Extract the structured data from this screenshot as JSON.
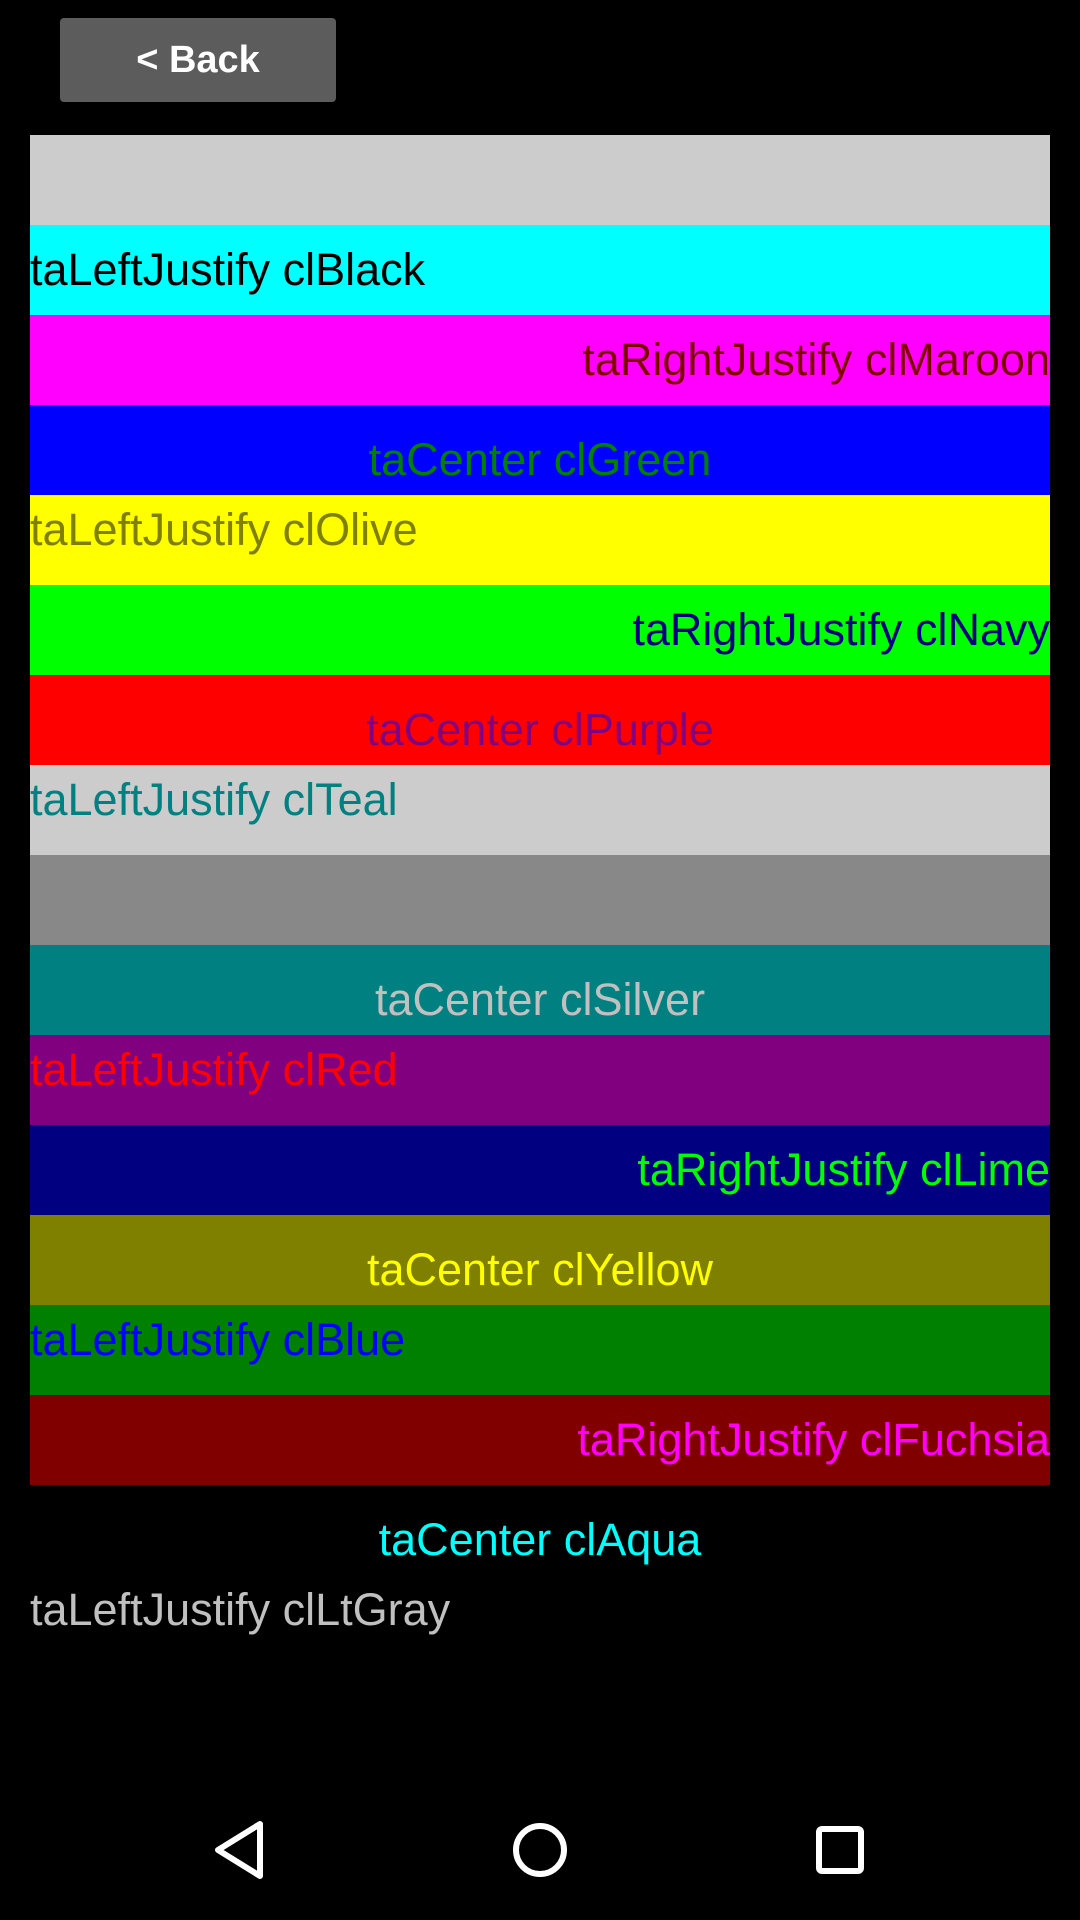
{
  "header": {
    "back_label": "< Back"
  },
  "rows": [
    {
      "text": "",
      "align": "left",
      "bg": "#cccccc",
      "fg": "#000000"
    },
    {
      "text": "taLeftJustify clBlack",
      "align": "left",
      "bg": "#00ffff",
      "fg": "#000000"
    },
    {
      "text": "taRightJustify clMaroon",
      "align": "right",
      "bg": "#ff00ff",
      "fg": "#800000"
    },
    {
      "text": "taCenter clGreen",
      "align": "center",
      "bg": "#0000ff",
      "fg": "#008000"
    },
    {
      "text": "taLeftJustify clOlive",
      "align": "left",
      "bg": "#ffff00",
      "fg": "#808000"
    },
    {
      "text": "taRightJustify clNavy",
      "align": "right",
      "bg": "#00ff00",
      "fg": "#000080"
    },
    {
      "text": "taCenter clPurple",
      "align": "center",
      "bg": "#ff0000",
      "fg": "#800080"
    },
    {
      "text": "taLeftJustify clTeal",
      "align": "left",
      "bg": "#cccccc",
      "fg": "#008080"
    },
    {
      "text": "",
      "align": "left",
      "bg": "#888888",
      "fg": "#808080"
    },
    {
      "text": "taCenter clSilver",
      "align": "center",
      "bg": "#008080",
      "fg": "#c0c0c0"
    },
    {
      "text": "taLeftJustify clRed",
      "align": "left",
      "bg": "#800080",
      "fg": "#ff0000"
    },
    {
      "text": "taRightJustify clLime",
      "align": "right",
      "bg": "#000080",
      "fg": "#00ff00"
    },
    {
      "text": "taCenter clYellow",
      "align": "center",
      "bg": "#808000",
      "fg": "#ffff00"
    },
    {
      "text": "taLeftJustify clBlue",
      "align": "left",
      "bg": "#008000",
      "fg": "#0000ff"
    },
    {
      "text": "taRightJustify clFuchsia",
      "align": "right",
      "bg": "#800000",
      "fg": "#ff00ff"
    },
    {
      "text": "taCenter clAqua",
      "align": "center",
      "bg": "#000000",
      "fg": "#00ffff"
    },
    {
      "text": "taLeftJustify clLtGray",
      "align": "left",
      "bg": "#000000",
      "fg": "#c0c0c0"
    }
  ],
  "nav": {
    "icons": [
      "back-triangle-icon",
      "home-circle-icon",
      "recents-square-icon"
    ],
    "color": "#ffffff"
  }
}
